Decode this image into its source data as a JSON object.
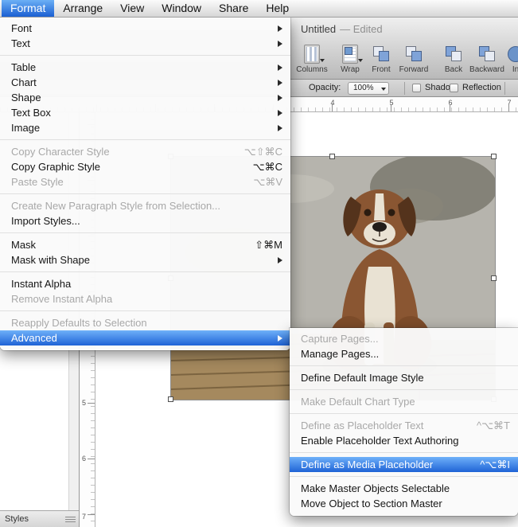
{
  "menu_bar": {
    "items": [
      {
        "label": "Format",
        "active": true
      },
      {
        "label": "Arrange"
      },
      {
        "label": "View"
      },
      {
        "label": "Window"
      },
      {
        "label": "Share"
      },
      {
        "label": "Help"
      }
    ]
  },
  "format_menu": {
    "items": [
      {
        "label": "Font",
        "submenu": true
      },
      {
        "label": "Text",
        "submenu": true
      },
      {
        "label": "Table",
        "submenu": true
      },
      {
        "label": "Chart",
        "submenu": true
      },
      {
        "label": "Shape",
        "submenu": true
      },
      {
        "label": "Text Box",
        "submenu": true
      },
      {
        "label": "Image",
        "submenu": true
      },
      {
        "label": "Copy Character Style",
        "shortcut": "⌥⇧⌘C",
        "disabled": true
      },
      {
        "label": "Copy Graphic Style",
        "shortcut": "⌥⌘C"
      },
      {
        "label": "Paste Style",
        "shortcut": "⌥⌘V",
        "disabled": true
      },
      {
        "label": "Create New Paragraph Style from Selection...",
        "disabled": true
      },
      {
        "label": "Import Styles..."
      },
      {
        "label": "Mask",
        "shortcut": "⇧⌘M"
      },
      {
        "label": "Mask with Shape",
        "submenu": true
      },
      {
        "label": "Instant Alpha"
      },
      {
        "label": "Remove Instant Alpha",
        "disabled": true
      },
      {
        "label": "Reapply Defaults to Selection",
        "disabled": true
      },
      {
        "label": "Advanced",
        "submenu": true,
        "highlighted": true
      }
    ]
  },
  "advanced_submenu": {
    "items": [
      {
        "label": "Capture Pages...",
        "disabled": true
      },
      {
        "label": "Manage Pages..."
      },
      {
        "label": "Define Default Image Style"
      },
      {
        "label": "Make Default Chart Type",
        "disabled": true
      },
      {
        "label": "Define as Placeholder Text",
        "shortcut": "^⌥⌘T",
        "disabled": true
      },
      {
        "label": "Enable Placeholder Text Authoring"
      },
      {
        "label": "Define as Media Placeholder",
        "shortcut": "^⌥⌘I",
        "highlighted": true
      },
      {
        "label": "Make Master Objects Selectable"
      },
      {
        "label": "Move Object to Section Master"
      }
    ]
  },
  "window": {
    "title": "Untitled",
    "title_state": "— Edited",
    "toolbar": {
      "buttons": [
        {
          "label": "Columns"
        },
        {
          "label": "Wrap"
        },
        {
          "label": "Front"
        },
        {
          "label": "Forward"
        },
        {
          "label": "Back"
        },
        {
          "label": "Backward"
        },
        {
          "label": "In"
        }
      ]
    },
    "format_bar": {
      "opacity_label": "Opacity:",
      "opacity_value": "100%",
      "shadow_label": "Shadow",
      "reflection_label": "Reflection"
    },
    "h_ruler_numbers": [
      "4",
      "5",
      "6",
      "7"
    ],
    "v_ruler_numbers": [
      "5",
      "6",
      "7"
    ],
    "styles_label": "Styles"
  },
  "colors": {
    "menu_highlight_top": "#6fb1f9",
    "menu_highlight_bottom": "#1f63d6",
    "menubar_highlight": "#2f6fe0",
    "disabled_text": "#a8a8a8"
  },
  "icons": {
    "submenu_arrow": "right-triangle",
    "dropdown_arrow": "down-triangle",
    "checkbox": "empty-square"
  }
}
